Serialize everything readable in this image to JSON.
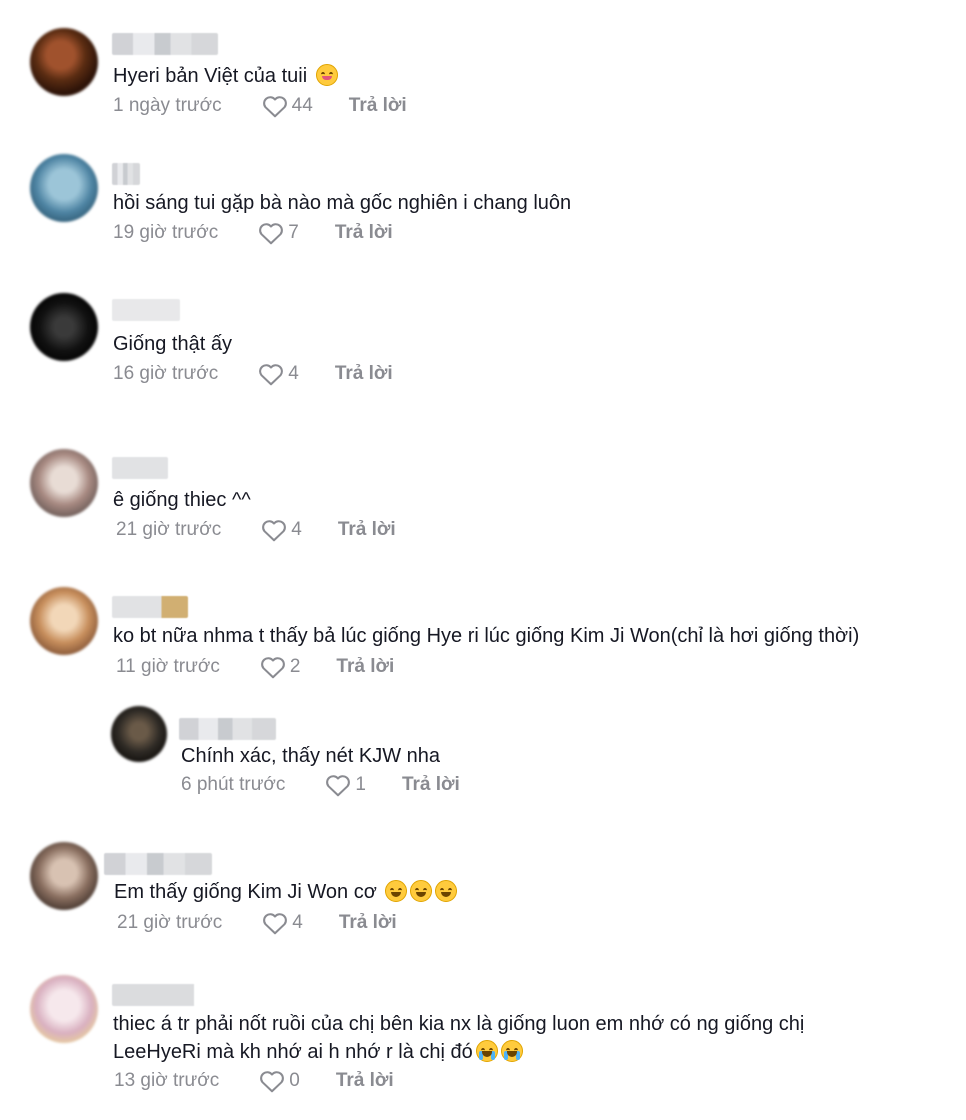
{
  "colors": {
    "text": "#161823",
    "meta": "#8a8b91",
    "emoji": "#ffcb3d"
  },
  "icons": {
    "like": "heart-outline-icon",
    "emoji_grin": "grinning-face-icon",
    "emoji_tongue": "face-savoring-food-icon",
    "emoji_cry": "loudly-crying-face-icon"
  },
  "comments": [
    {
      "text": "Hyeri bản Việt của tuii",
      "time": "1 ngày trước",
      "likes": "44",
      "reply": "Trả lời"
    },
    {
      "text": "hồi sáng tui gặp bà nào mà gốc nghiên i chang luôn",
      "time": "19 giờ trước",
      "likes": "7",
      "reply": "Trả lời"
    },
    {
      "text": "Giống thật ấy",
      "time": "16 giờ trước",
      "likes": "4",
      "reply": "Trả lời"
    },
    {
      "text": "ê giống thiec ^^",
      "time": "21 giờ trước",
      "likes": "4",
      "reply": "Trả lời"
    },
    {
      "text": "ko bt nữa nhma t thấy bả lúc giống Hye ri lúc giống Kim Ji Won(chỉ là hơi giống thời)",
      "time": "11 giờ trước",
      "likes": "2",
      "reply": "Trả lời"
    },
    {
      "text": "Chính xác, thấy nét KJW nha",
      "time": "6 phút trước",
      "likes": "1",
      "reply": "Trả lời"
    },
    {
      "text": "Em thấy giống Kim Ji Won cơ",
      "time": "21 giờ trước",
      "likes": "4",
      "reply": "Trả lời"
    },
    {
      "text_line1": "thiec á tr phải nốt ruồi của chị bên kia nx là giống luon em nhớ có ng giống chị",
      "text_line2": "LeeHyeRi mà kh nhớ ai h nhớ r là chị đó",
      "time": "13 giờ trước",
      "likes": "0",
      "reply": "Trả lời"
    }
  ]
}
